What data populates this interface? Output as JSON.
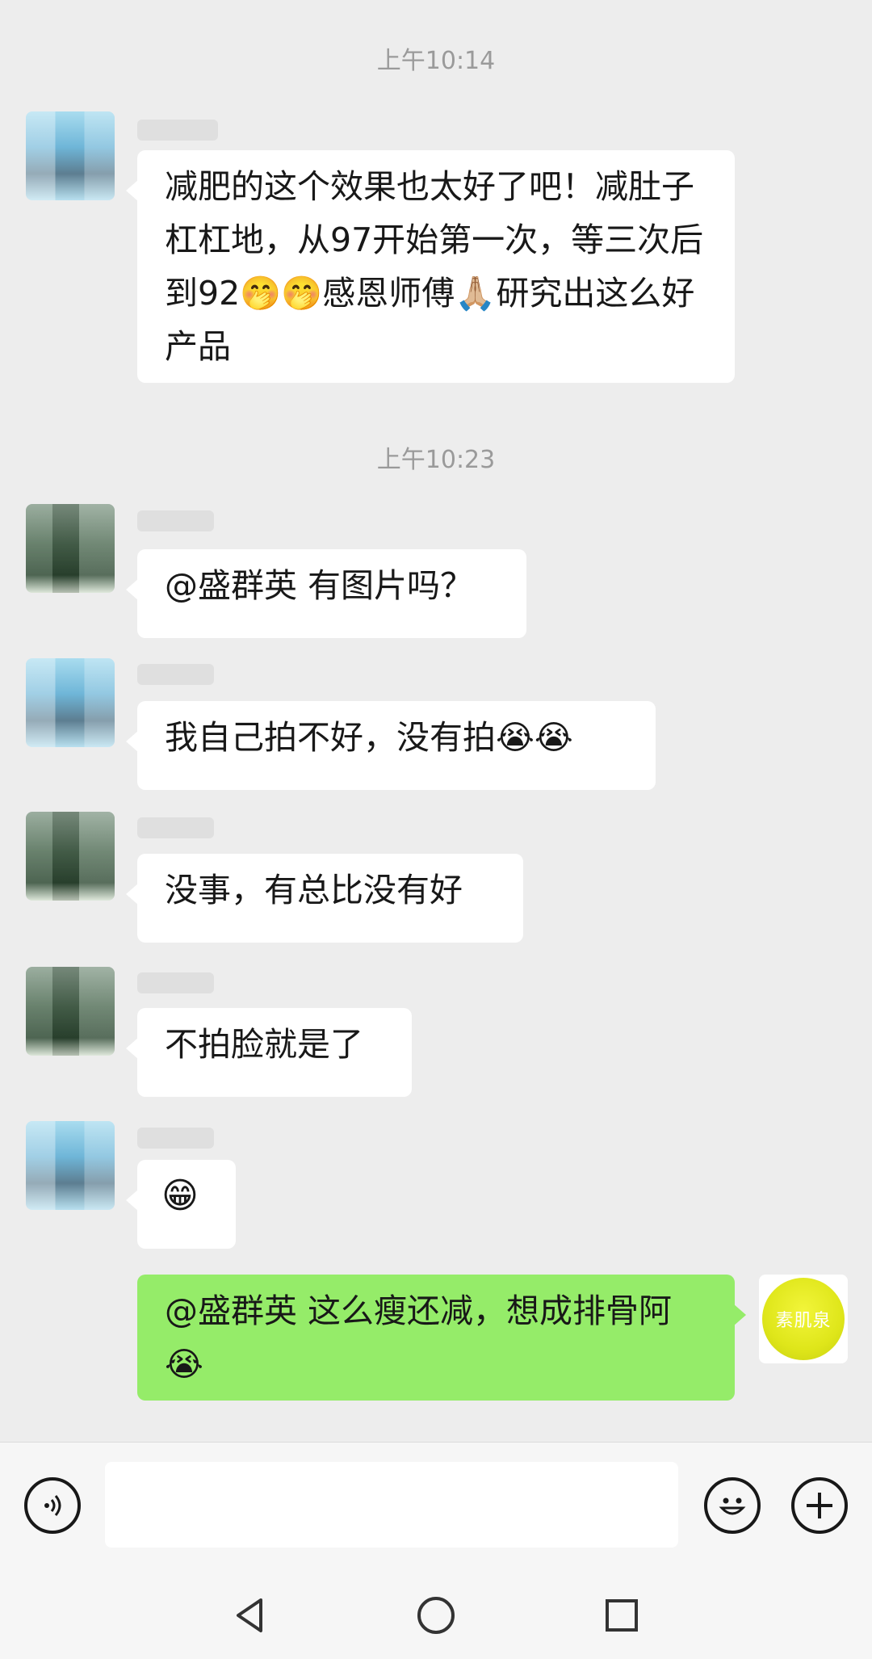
{
  "chat": {
    "timestamps": [
      "上午10:14",
      "上午10:23"
    ],
    "messages": [
      {
        "text": "减肥的这个效果也太好了吧！减肚子杠杠地，从97开始第一次，等三次后到92🤭🤭感恩师傅🙏🏼研究出这么好产品"
      },
      {
        "text": "@盛群英  有图片吗？"
      },
      {
        "text": "我自己拍不好，没有拍😭😭"
      },
      {
        "text": "没事，有总比没有好"
      },
      {
        "text": "不拍脸就是了"
      },
      {
        "text": "😁"
      },
      {
        "text": "@盛群英  这么瘦还减，想成排骨阿😭"
      }
    ],
    "brand_avatar_text": "素肌泉"
  },
  "input_bar": {
    "voice_icon": "voice-icon",
    "emoji_icon": "emoji-icon",
    "plus_icon": "plus-icon",
    "field_value": ""
  },
  "nav_bar": {
    "back_icon": "back-triangle-icon",
    "home_icon": "home-circle-icon",
    "recents_icon": "recents-square-icon"
  },
  "colors": {
    "background": "#ededed",
    "incoming_bubble": "#ffffff",
    "outgoing_bubble": "#95ec69",
    "timestamp": "#9a9a9a"
  }
}
